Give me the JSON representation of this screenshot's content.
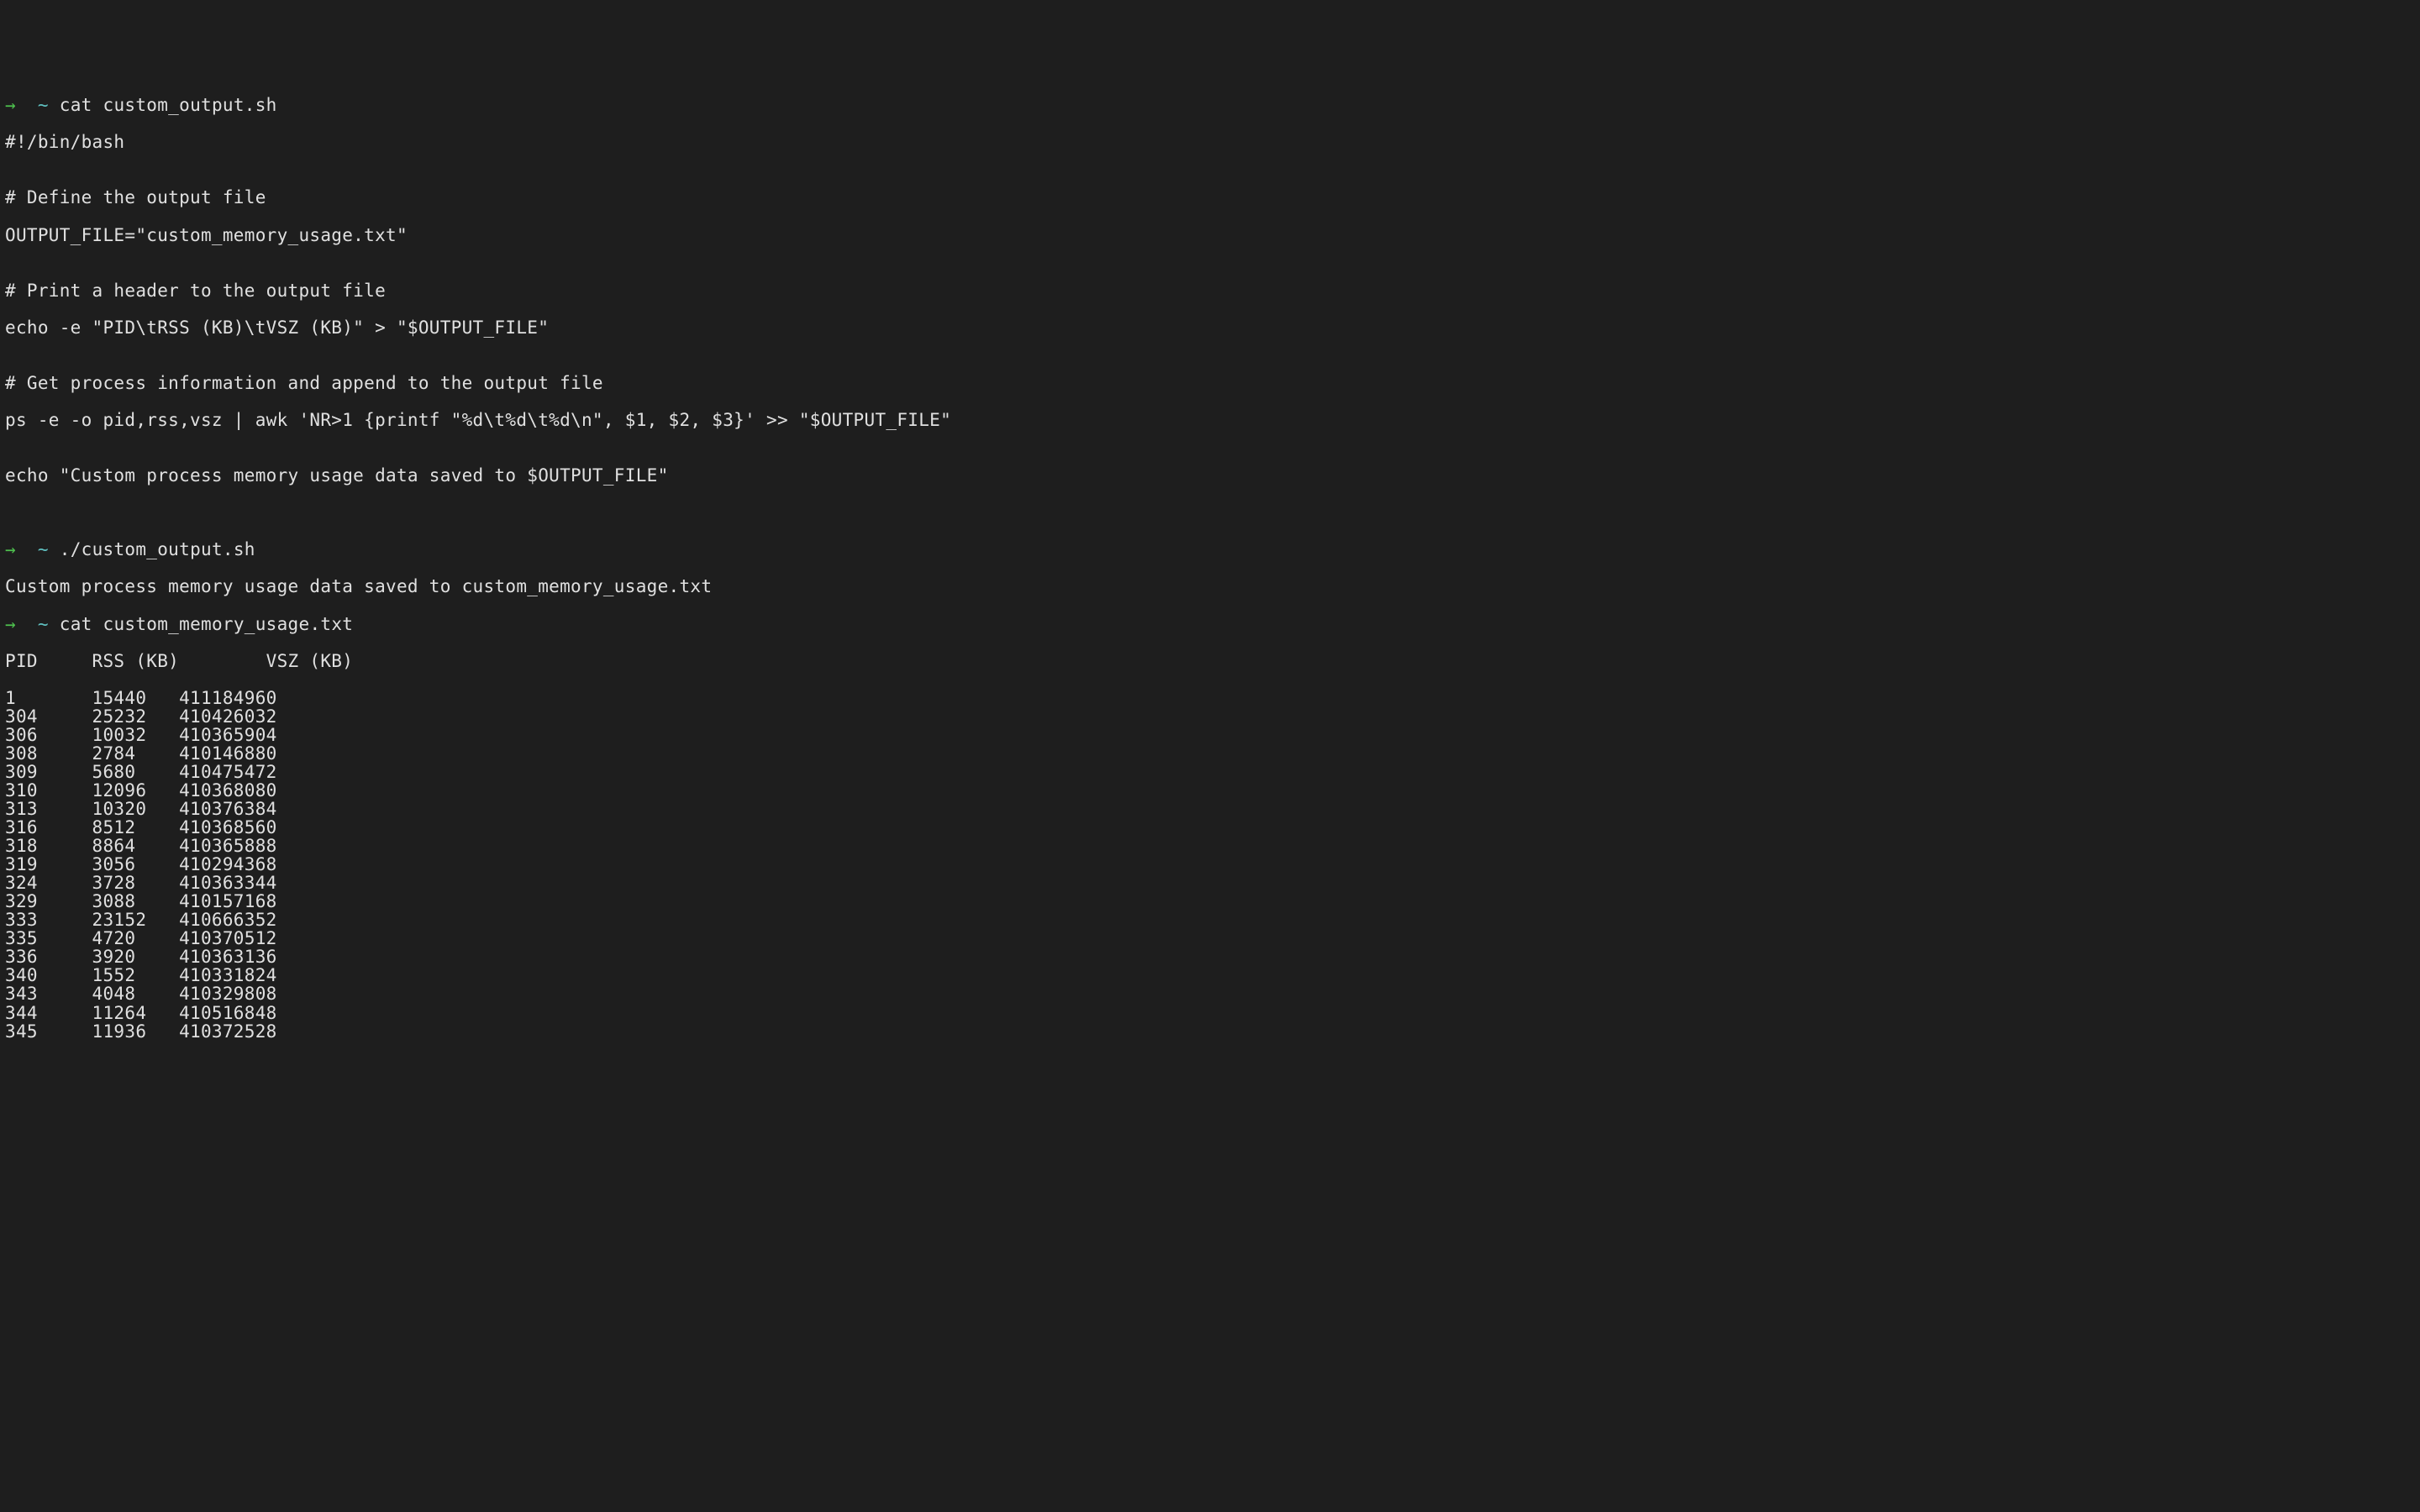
{
  "prompt": {
    "arrow": "→",
    "tilde": "~"
  },
  "commands": {
    "cat_script": "cat custom_output.sh",
    "run_script": "./custom_output.sh",
    "cat_output": "cat custom_memory_usage.txt"
  },
  "script": {
    "shebang": "#!/bin/bash",
    "blank": "",
    "comment1": "# Define the output file",
    "line1": "OUTPUT_FILE=\"custom_memory_usage.txt\"",
    "comment2": "# Print a header to the output file",
    "line2": "echo -e \"PID\\tRSS (KB)\\tVSZ (KB)\" > \"$OUTPUT_FILE\"",
    "comment3": "# Get process information and append to the output file",
    "line3": "ps -e -o pid,rss,vsz | awk 'NR>1 {printf \"%d\\t%d\\t%d\\n\", $1, $2, $3}' >> \"$OUTPUT_FILE\"",
    "line4": "echo \"Custom process memory usage data saved to $OUTPUT_FILE\""
  },
  "run_output": "Custom process memory usage data saved to custom_memory_usage.txt",
  "table_header": "PID     RSS (KB)        VSZ (KB)",
  "process_data": [
    {
      "pid": "1",
      "rss": "15440",
      "vsz": "411184960"
    },
    {
      "pid": "304",
      "rss": "25232",
      "vsz": "410426032"
    },
    {
      "pid": "306",
      "rss": "10032",
      "vsz": "410365904"
    },
    {
      "pid": "308",
      "rss": "2784",
      "vsz": "410146880"
    },
    {
      "pid": "309",
      "rss": "5680",
      "vsz": "410475472"
    },
    {
      "pid": "310",
      "rss": "12096",
      "vsz": "410368080"
    },
    {
      "pid": "313",
      "rss": "10320",
      "vsz": "410376384"
    },
    {
      "pid": "316",
      "rss": "8512",
      "vsz": "410368560"
    },
    {
      "pid": "318",
      "rss": "8864",
      "vsz": "410365888"
    },
    {
      "pid": "319",
      "rss": "3056",
      "vsz": "410294368"
    },
    {
      "pid": "324",
      "rss": "3728",
      "vsz": "410363344"
    },
    {
      "pid": "329",
      "rss": "3088",
      "vsz": "410157168"
    },
    {
      "pid": "333",
      "rss": "23152",
      "vsz": "410666352"
    },
    {
      "pid": "335",
      "rss": "4720",
      "vsz": "410370512"
    },
    {
      "pid": "336",
      "rss": "3920",
      "vsz": "410363136"
    },
    {
      "pid": "340",
      "rss": "1552",
      "vsz": "410331824"
    },
    {
      "pid": "343",
      "rss": "4048",
      "vsz": "410329808"
    },
    {
      "pid": "344",
      "rss": "11264",
      "vsz": "410516848"
    },
    {
      "pid": "345",
      "rss": "11936",
      "vsz": "410372528"
    }
  ]
}
